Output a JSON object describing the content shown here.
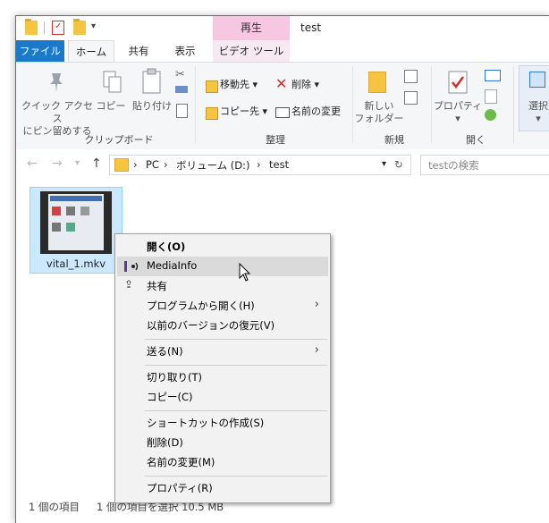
{
  "window": {
    "title": "test",
    "contextual_tab": "再生"
  },
  "tabs": {
    "file": "ファイル",
    "home": "ホーム",
    "share": "共有",
    "view": "表示",
    "video_tools": "ビデオ ツール"
  },
  "ribbon": {
    "quick_access": "クイック アクセス\nにピン留めする",
    "copy": "コピー",
    "paste": "貼り付け",
    "clipboard_group": "クリップボード",
    "move_to": "移動先",
    "copy_to": "コピー先",
    "delete": "削除",
    "rename": "名前の変更",
    "organize_group": "整理",
    "new_folder": "新しい\nフォルダー",
    "new_group": "新規",
    "properties": "プロパティ",
    "open_group": "開く",
    "select": "選択"
  },
  "address": {
    "crumbs": [
      "PC",
      "ボリューム (D:)",
      "test"
    ],
    "search_placeholder": "testの検索"
  },
  "file": {
    "name": "vital_1.mkv"
  },
  "status": {
    "count": "1 個の項目",
    "selected": "1 個の項目を選択  10.5 MB"
  },
  "context_menu": {
    "open": "開く(O)",
    "mediainfo": "MediaInfo",
    "share": "共有",
    "open_with": "プログラムから開く(H)",
    "restore": "以前のバージョンの復元(V)",
    "send_to": "送る(N)",
    "cut": "切り取り(T)",
    "copy": "コピー(C)",
    "create_shortcut": "ショートカットの作成(S)",
    "delete": "削除(D)",
    "rename": "名前の変更(M)",
    "properties": "プロパティ(R)"
  },
  "colors": {
    "accent": "#1979ca",
    "contextual_tab": "#f7c6e0",
    "selection": "#cce8ff",
    "menu_bg": "#f2f2f2",
    "menu_hover": "#dadada"
  }
}
